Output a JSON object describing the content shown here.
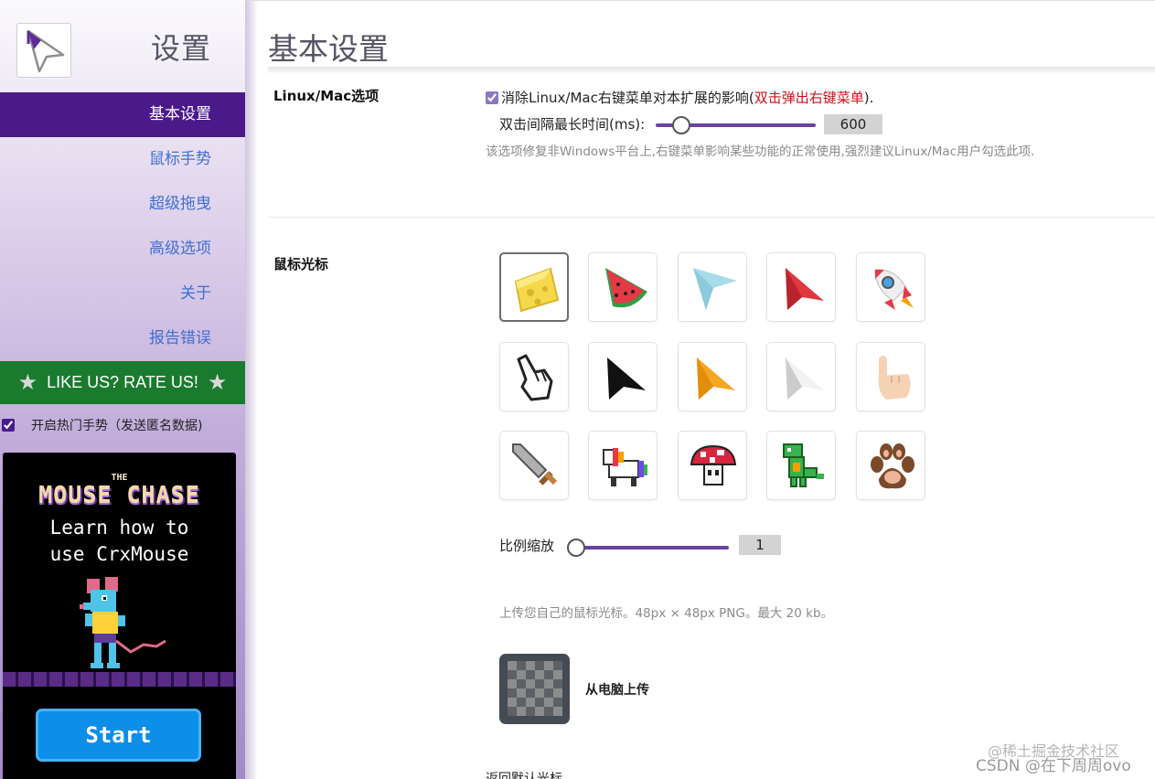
{
  "sidebar": {
    "title": "设置",
    "nav": [
      {
        "label": "基本设置",
        "active": true
      },
      {
        "label": "鼠标手势",
        "active": false
      },
      {
        "label": "超级拖曳",
        "active": false
      },
      {
        "label": "高级选项",
        "active": false
      },
      {
        "label": "关于",
        "active": false
      },
      {
        "label": "报告错误",
        "active": false
      }
    ],
    "rate_label": "LIKE US? RATE US!",
    "hot_gestures_label": "开启热门手势（发送匿名数据)",
    "hot_gestures_checked": true,
    "promo": {
      "the": "THE",
      "title": "MOUSE CHASE",
      "line1": "Learn how to",
      "line2": "use CrxMouse",
      "start": "Start"
    }
  },
  "main": {
    "title": "基本设置",
    "linux": {
      "label": "Linux/Mac选项",
      "checkbox_text": "消除Linux/Mac右键菜单对本扩展的影响(",
      "checkbox_red": "双击弹出右键菜单",
      "checkbox_tail": ").",
      "checked": true,
      "interval_label": "双击间隔最长时间(ms):",
      "interval_value": "600",
      "interval_fraction": 0.1,
      "hint": "该选项修复非Windows平台上,右键菜单影响某些功能的正常使用,强烈建议Linux/Mac用户勾选此项."
    },
    "cursor": {
      "label": "鼠标光标",
      "icons": [
        "cheese-icon",
        "watermelon-icon",
        "paper-plane-icon",
        "red-arrow-icon",
        "rocket-icon",
        "pointing-hand-outline-icon",
        "black-arrow-icon",
        "orange-arrow-icon",
        "white-arrow-icon",
        "pointing-hand-icon",
        "pixel-sword-icon",
        "pixel-unicorn-icon",
        "pixel-mushroom-icon",
        "pixel-dinosaur-icon",
        "paw-icon"
      ],
      "selected_index": 0,
      "scale_label": "比例缩放",
      "scale_value": "1",
      "scale_fraction": 0.0,
      "upload_hint": "上传您自己的鼠标光标。48px × 48px PNG。最大 20 kb。",
      "upload_label": "从电脑上传",
      "reset_label": "返回默认光标"
    }
  },
  "watermark": {
    "line1": "@稀土掘金技术社区",
    "line2": "CSDN @在下周周ovo"
  },
  "colors": {
    "accent": "#4b1a8a",
    "link": "#3f6fd2",
    "rate_bg": "#1a7a2e",
    "slider": "#6b41a5",
    "warning_red": "#d0101b"
  }
}
